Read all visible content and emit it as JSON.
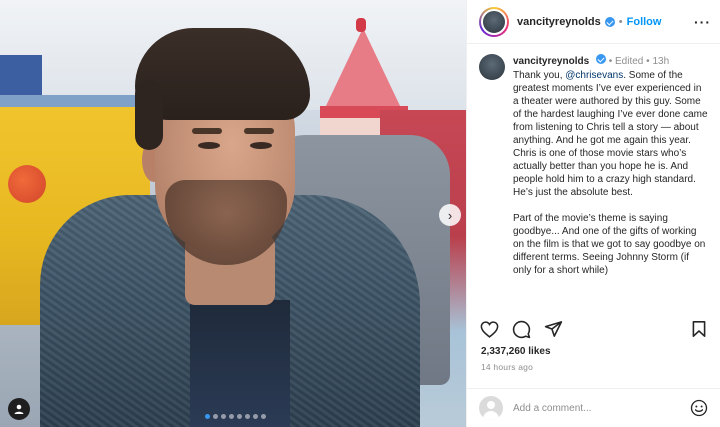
{
  "post": {
    "username": "vancityreynolds",
    "follow_label": "Follow",
    "separator": "•",
    "more_label": "···"
  },
  "caption": {
    "username": "vancityreynolds",
    "edited_label": "Edited",
    "time_ago": "13h",
    "text_before_mention": "Thank you, ",
    "mention": "@chrisevans",
    "text_after_mention": ". Some of the greatest moments I’ve ever experienced in a theater were authored by this guy. Some of the hardest laughing I’ve ever done came from listening to Chris tell a story — about anything. And he got me again this year. Chris is one of those movie stars who’s actually better than you hope he is. And people hold him to a crazy high standard. He’s just the absolute best.",
    "paragraph2": "Part of the movie’s theme is saying goodbye... And one of the gifts of working on the film is that we got to say goodbye on different terms. Seeing Johnny Storm (if only for a short while)"
  },
  "stats": {
    "likes": "2,337,260 likes",
    "timestamp": "14 hours ago"
  },
  "comment": {
    "placeholder": "Add a comment..."
  },
  "carousel": {
    "next_glyph": "›",
    "dot_count": 8,
    "active_index": 0
  },
  "icons": {
    "like": "heart-icon",
    "comment": "comment-icon",
    "share": "share-icon",
    "save": "bookmark-icon",
    "emoji": "emoji-icon",
    "tag": "user-tag-icon",
    "verified": "verified-badge-icon"
  },
  "colors": {
    "link": "#0095f6",
    "mention": "#00376b",
    "verified": "#3897f0",
    "muted": "#8e8e8e"
  }
}
